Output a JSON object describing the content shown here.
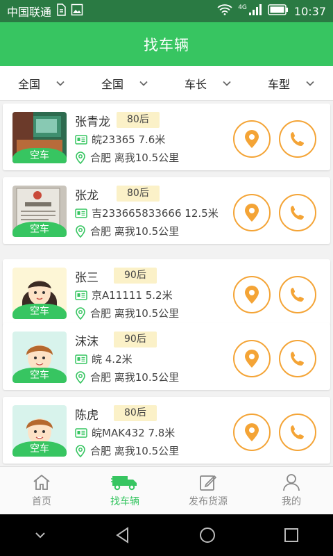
{
  "status_bar": {
    "carrier": "中国联通",
    "network": "4G",
    "time": "10:37"
  },
  "app_bar": {
    "title": "找车辆"
  },
  "filters": [
    {
      "label": "全国"
    },
    {
      "label": "全国"
    },
    {
      "label": "车长"
    },
    {
      "label": "车型"
    }
  ],
  "drivers": [
    {
      "name": "张青龙",
      "age_group": "80后",
      "plate_info": "皖23365 7.6米",
      "location": "合肥 离我10.5公里",
      "status": "空车",
      "avatar": "photo-room-icon"
    },
    {
      "name": "张龙",
      "age_group": "80后",
      "plate_info": "吉233665833666 12.5米",
      "location": "合肥 离我10.5公里",
      "status": "空车",
      "avatar": "photo-license-icon"
    },
    {
      "name": "张三",
      "age_group": "90后",
      "plate_info": "京A11111 5.2米",
      "location": "合肥 离我10.5公里",
      "status": "空车",
      "avatar": "girl-avatar-icon"
    },
    {
      "name": "沫沫",
      "age_group": "90后",
      "plate_info": "皖 4.2米",
      "location": "合肥 离我10.5公里",
      "status": "空车",
      "avatar": "boy-avatar-icon"
    },
    {
      "name": "陈虎",
      "age_group": "80后",
      "plate_info": "皖MAK432 7.8米",
      "location": "合肥 离我10.5公里",
      "status": "空车",
      "avatar": "boy-avatar-icon"
    }
  ],
  "tabs": [
    {
      "label": "首页",
      "icon": "home-icon",
      "active": false
    },
    {
      "label": "找车辆",
      "icon": "truck-icon",
      "active": true
    },
    {
      "label": "发布货源",
      "icon": "edit-icon",
      "active": false
    },
    {
      "label": "我的",
      "icon": "person-icon",
      "active": false
    }
  ],
  "colors": {
    "primary": "#37c561",
    "status_bar": "#2a7a43",
    "accent": "#f4a436",
    "age_badge": "#fbf1c8"
  }
}
